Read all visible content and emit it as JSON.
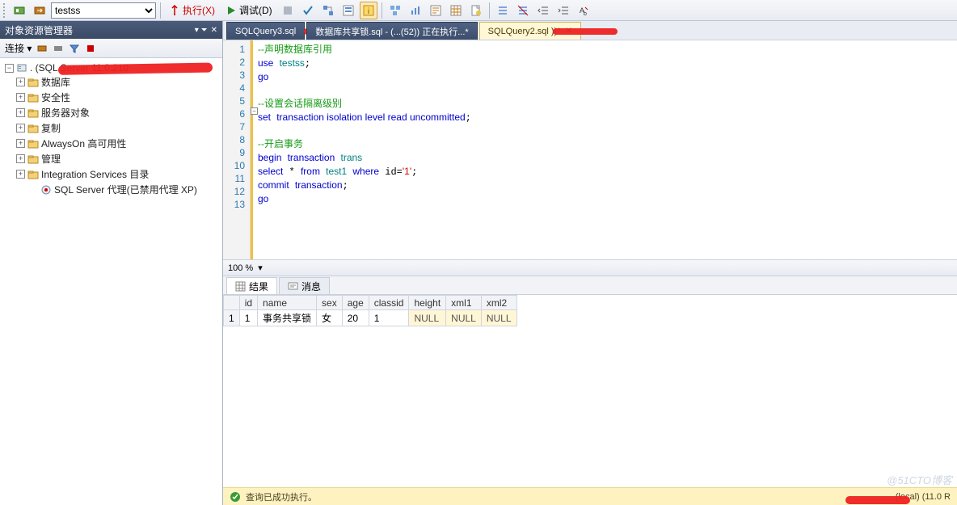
{
  "toolbar": {
    "db_selected": "testss",
    "execute_label": "执行(X)",
    "debug_label": "调试(D)"
  },
  "explorer": {
    "title": "对象资源管理器",
    "connect_label": "连接 ▾",
    "root": ". (SQL Server 11.0.210",
    "nodes": [
      "数据库",
      "安全性",
      "服务器对象",
      "复制",
      "AlwaysOn 高可用性",
      "管理",
      "Integration Services 目录",
      "SQL Server 代理(已禁用代理 XP)"
    ]
  },
  "tabs": [
    {
      "label": "SQLQuery3.sql",
      "active": false
    },
    {
      "label": "数据库共享锁.sql - (...(52)) 正在执行...*",
      "active": false
    },
    {
      "label": "SQLQuery2.sql                           ))*",
      "active": true
    }
  ],
  "editor": {
    "lines": 13,
    "code_lines": [
      {
        "t": "cm",
        "v": "--声明数据库引用"
      },
      {
        "raw": "<span class='kw'>use</span> <span class='ident'>testss</span>;"
      },
      {
        "t": "kw",
        "v": "go"
      },
      {
        "t": "",
        "v": ""
      },
      {
        "t": "cm",
        "v": "--设置会话隔离级别"
      },
      {
        "raw": "<span class='kw'>set</span> <span class='kw'>transaction isolation level read uncommitted</span>;"
      },
      {
        "t": "",
        "v": ""
      },
      {
        "t": "cm",
        "v": "--开启事务"
      },
      {
        "raw": "<span class='kw'>begin</span> <span class='kw'>transaction</span> <span class='ident'>trans</span>"
      },
      {
        "raw": "<span class='kw'>select</span> * <span class='kw'>from</span> <span class='ident'>test1</span> <span class='kw'>where</span> id=<span class='str'>'1'</span>;"
      },
      {
        "raw": "<span class='kw'>commit</span> <span class='kw'>transaction</span>;"
      },
      {
        "t": "kw",
        "v": "go"
      },
      {
        "t": "",
        "v": ""
      }
    ]
  },
  "zoom": "100 %",
  "result_tabs": {
    "results": "结果",
    "messages": "消息"
  },
  "grid": {
    "headers": [
      "",
      "id",
      "name",
      "sex",
      "age",
      "classid",
      "height",
      "xml1",
      "xml2"
    ],
    "row_num": "1",
    "row": [
      "1",
      "事务共享锁",
      "女",
      "20",
      "1",
      "NULL",
      "NULL",
      "NULL"
    ]
  },
  "status": {
    "success": "查询已成功执行。",
    "server": "(local) (11.0 R"
  },
  "watermark": "@51CTO博客"
}
